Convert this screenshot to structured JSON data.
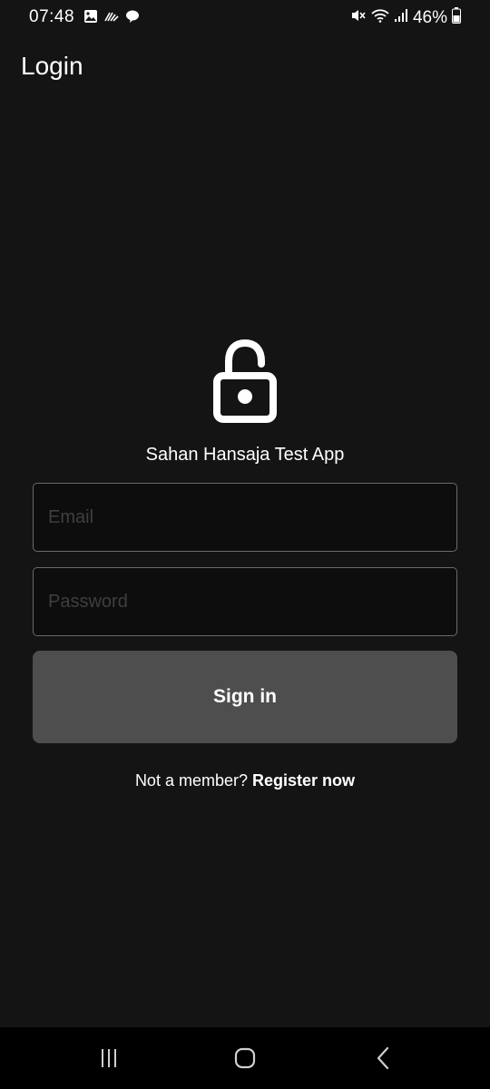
{
  "status_bar": {
    "time": "07:48",
    "battery": "46%",
    "left_icons": [
      "gallery-icon",
      "scribble-icon",
      "chat-bubble-icon"
    ],
    "right_icons": [
      "mute-icon",
      "wifi-icon",
      "signal-icon",
      "battery-icon"
    ]
  },
  "app_bar": {
    "title": "Login"
  },
  "login": {
    "icon": "unlocked-padlock-icon",
    "app_name": "Sahan Hansaja Test App",
    "email_placeholder": "Email",
    "email_value": "",
    "password_placeholder": "Password",
    "password_value": "",
    "sign_in_label": "Sign in",
    "register_prompt": "Not a member?",
    "register_link": "Register now"
  },
  "nav_bar": {
    "items": [
      "recents-icon",
      "home-icon",
      "back-icon"
    ]
  },
  "colors": {
    "background": "#141414",
    "button": "#4e4e4e",
    "input_border": "#6a6a6a",
    "placeholder": "#3f3f3f",
    "nav_bar": "#000000"
  }
}
